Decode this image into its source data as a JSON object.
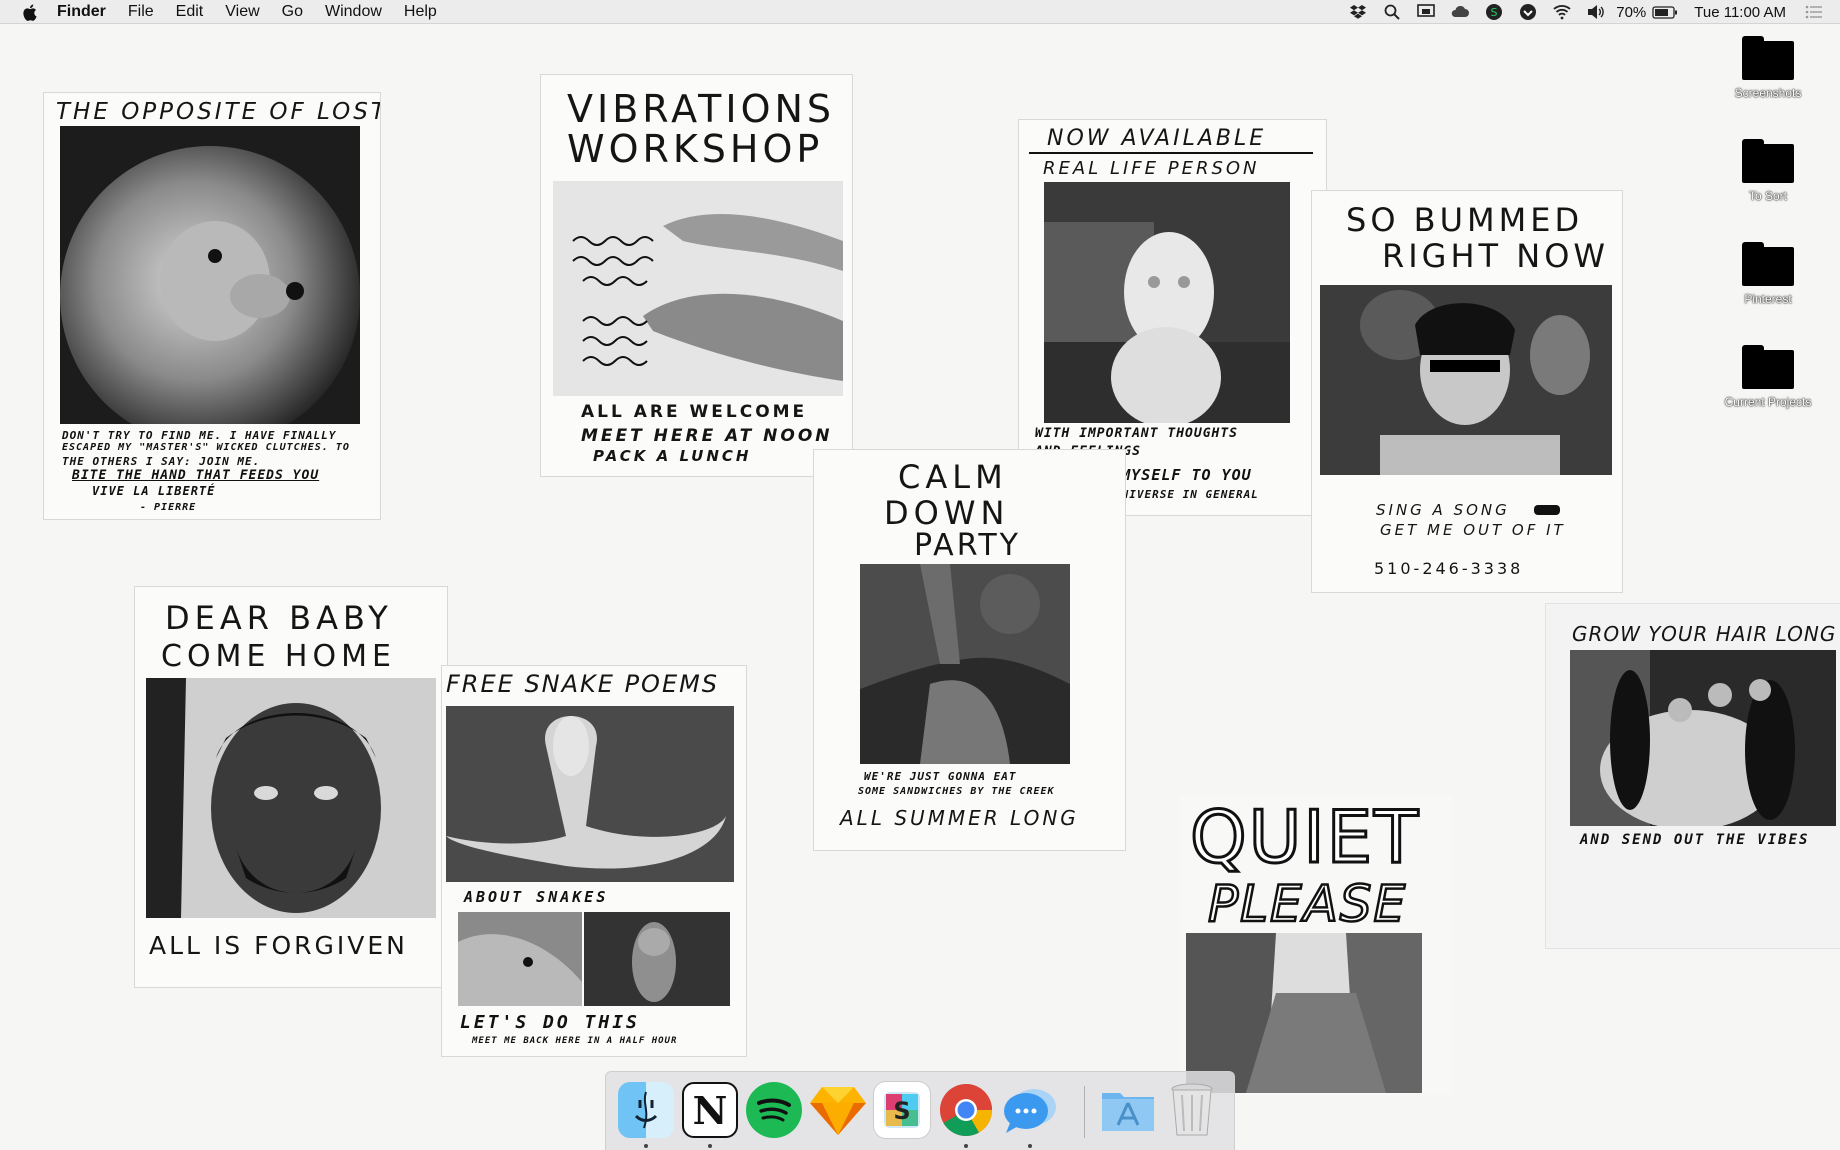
{
  "menubar": {
    "app_name": "Finder",
    "items": [
      "File",
      "Edit",
      "View",
      "Go",
      "Window",
      "Help"
    ],
    "battery": "70%",
    "clock": "Tue 11:00 AM"
  },
  "desktop_icons": [
    "Screenshots",
    "To Sort",
    "Pinterest",
    "Current Projects"
  ],
  "posters": {
    "lost": {
      "title": "THE OPPOSITE OF LOST",
      "line1": "DON'T TRY TO FIND ME. I HAVE FINALLY",
      "line2": "ESCAPED MY \"MASTER'S\" WICKED CLUTCHES. TO",
      "line3": "THE OTHERS I SAY: JOIN ME.",
      "line4": "BITE THE HAND THAT FEEDS YOU",
      "line5": "VIVE LA LIBERTÉ",
      "line6": "- PIERRE"
    },
    "vibrations": {
      "title1": "VIBRATIONS",
      "title2": "WORKSHOP",
      "line1": "ALL ARE WELCOME",
      "line2": "MEET HERE AT NOON",
      "line3": "PACK A LUNCH"
    },
    "available": {
      "title": "NOW AVAILABLE",
      "subtitle": "REAL LIFE PERSON",
      "line1": "WITH IMPORTANT THOUGHTS",
      "line2": "AND FEELINGS",
      "line3": "I OFFER MYSELF TO YOU",
      "line4": "AND THE UNIVERSE IN GENERAL"
    },
    "bummed": {
      "title1": "SO BUMMED",
      "title2": "RIGHT NOW",
      "line1": "SING A SONG",
      "line2": "GET ME OUT OF IT",
      "phone": "510-246-3338"
    },
    "calm": {
      "title1": "CALM",
      "title2": "DOWN",
      "title3": "PARTY",
      "line1": "WE'RE JUST GONNA EAT",
      "line2": "SOME SANDWICHES BY THE CREEK",
      "line3": "ALL SUMMER LONG"
    },
    "baby": {
      "title1": "DEAR BABY",
      "title2": "COME HOME",
      "footer": "ALL IS FORGIVEN"
    },
    "snake": {
      "title": "FREE SNAKE POEMS",
      "line1": "ABOUT SNAKES",
      "line2": "LET'S DO THIS",
      "line3": "MEET ME BACK HERE IN A HALF HOUR"
    },
    "quiet": {
      "title1": "QUIET",
      "title2": "PLEASE"
    },
    "hair": {
      "title": "GROW YOUR HAIR LONG",
      "footer": "AND SEND OUT THE VIBES"
    }
  },
  "dock": {
    "apps": [
      "finder-icon",
      "notion-icon",
      "spotify-icon",
      "sketch-icon",
      "slack-icon",
      "chrome-icon",
      "messages-icon"
    ],
    "extras": [
      "applications-folder-icon",
      "trash-icon"
    ],
    "notion_glyph": "N"
  }
}
